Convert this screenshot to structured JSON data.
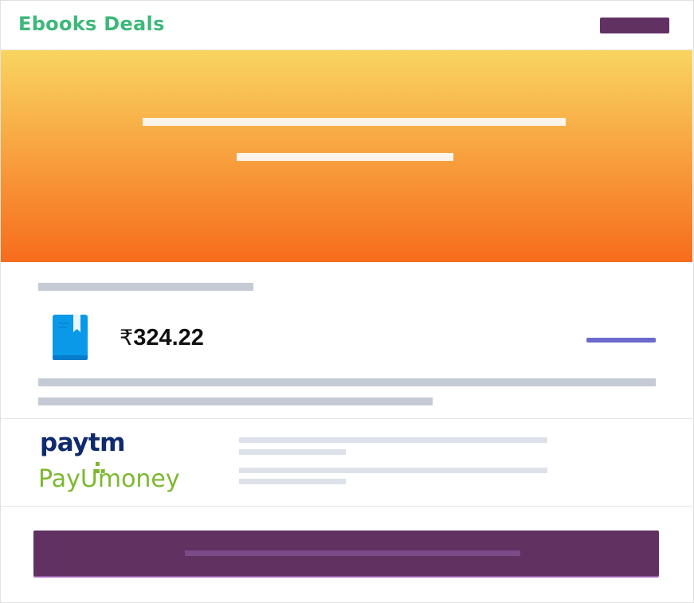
{
  "header": {
    "brand_title": "Ebooks Deals",
    "brand_color": "#3db87a",
    "action_button_color": "#613161"
  },
  "hero": {
    "gradient_top": "#f8d560",
    "gradient_bottom": "#f76c1c"
  },
  "product": {
    "icon": "google-play-books-icon",
    "currency_symbol": "₹",
    "amount": "324.22",
    "accent_color": "#6a6acd"
  },
  "payments": {
    "paytm_label": "Paytm",
    "paytm_logo_text": "paytm",
    "payu_logo_text": "PayU money",
    "payu_prefix": "PayU",
    "payu_suffix": "money"
  },
  "cta": {
    "color": "#613161"
  }
}
